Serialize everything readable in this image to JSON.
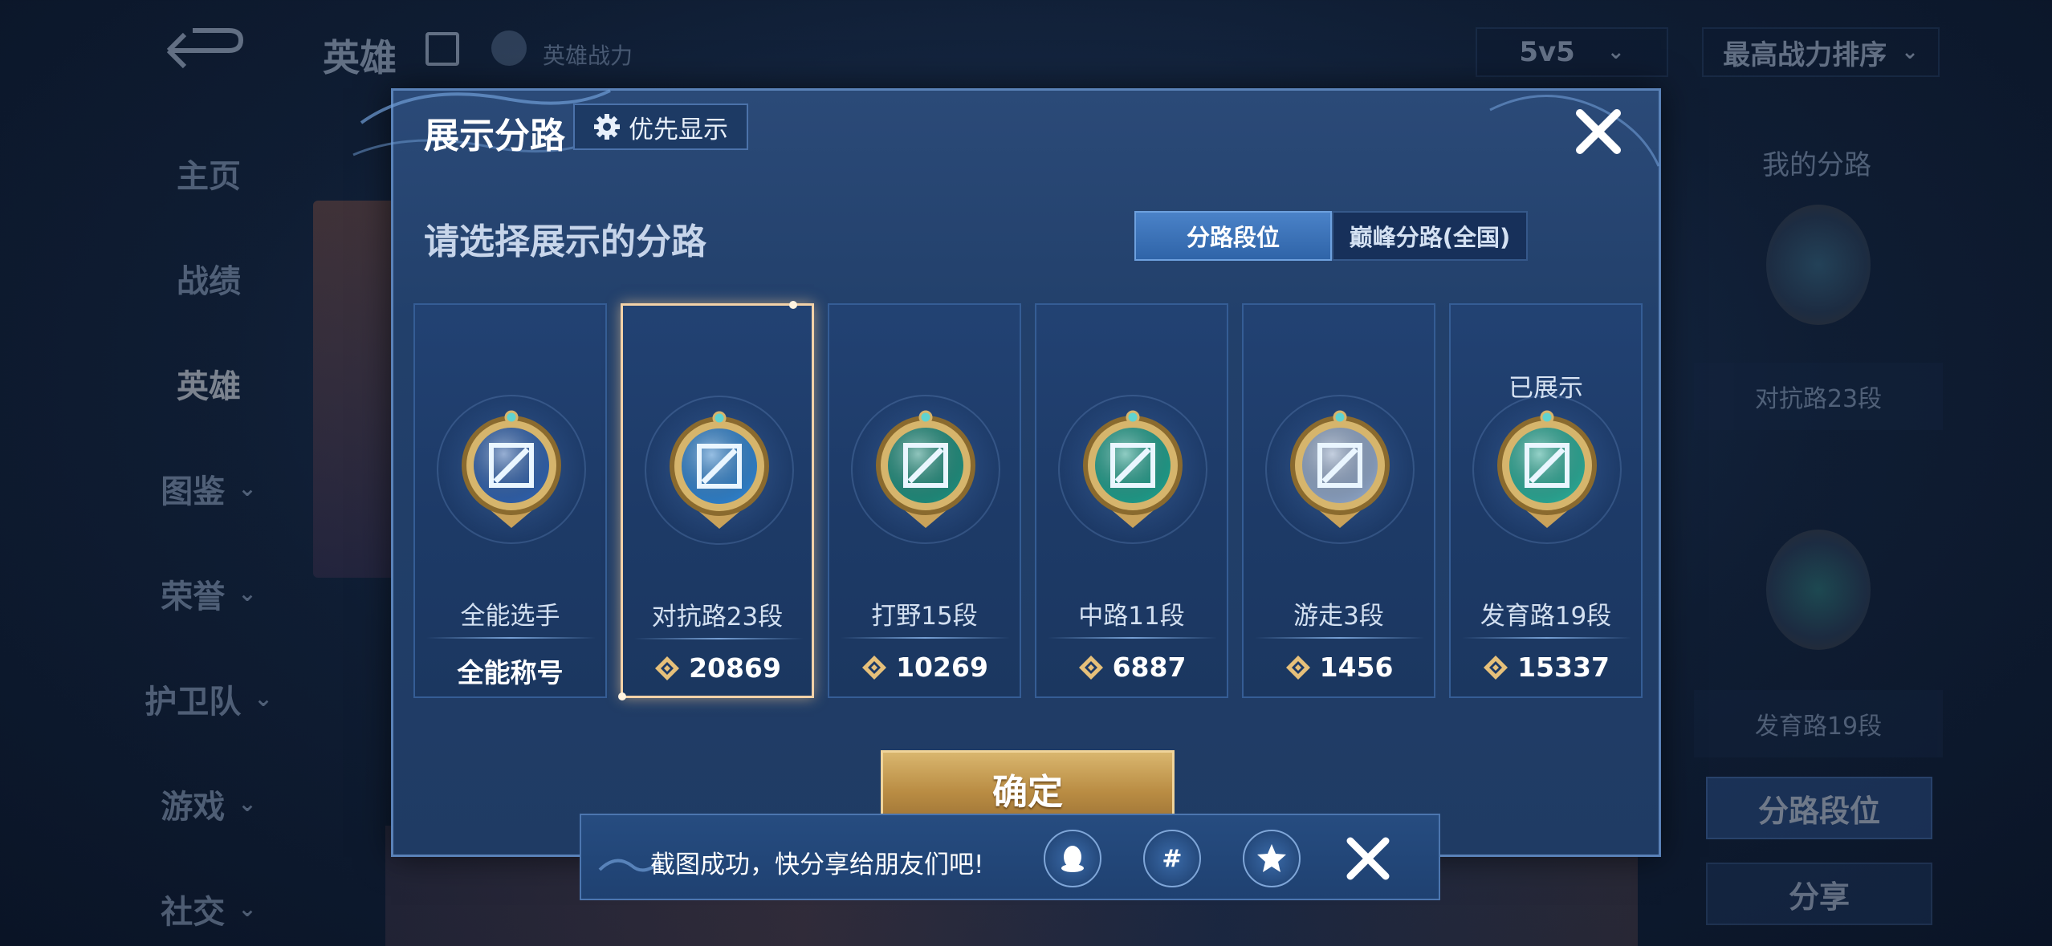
{
  "background": {
    "title": "英雄",
    "subtitle": "英雄战力",
    "mode_select": "5v5",
    "sort_select": "最高战力排序",
    "sidebar": [
      {
        "label": "主页",
        "has_chevron": false
      },
      {
        "label": "战绩",
        "has_chevron": false
      },
      {
        "label": "英雄",
        "has_chevron": false,
        "active": true
      },
      {
        "label": "图鉴",
        "has_chevron": true
      },
      {
        "label": "荣誉",
        "has_chevron": true
      },
      {
        "label": "护卫队",
        "has_chevron": true
      },
      {
        "label": "游戏",
        "has_chevron": true
      },
      {
        "label": "社交",
        "has_chevron": true
      }
    ],
    "right_panel": {
      "title": "我的分路",
      "label1": "对抗路23段",
      "label2": "发育路19段",
      "button1": "分路段位",
      "button2": "分享"
    }
  },
  "modal": {
    "title": "展示分路",
    "priority_button": "优先显示",
    "prompt": "请选择展示的分路",
    "tabs": [
      {
        "label": "分路段位",
        "active": true
      },
      {
        "label": "巅峰分路(全国)",
        "active": false
      }
    ],
    "cards": [
      {
        "rank": "全能选手",
        "score": "全能称号",
        "show_diamond": false,
        "shown_label": "",
        "emblem": "all-round-emblem-icon",
        "emblem_color": "#2f5fa8",
        "selected": false
      },
      {
        "rank": "对抗路23段",
        "score": "20869",
        "show_diamond": true,
        "shown_label": "",
        "emblem": "clash-lane-emblem-icon",
        "emblem_color": "#2f7fc8",
        "selected": true
      },
      {
        "rank": "打野15段",
        "score": "10269",
        "show_diamond": true,
        "shown_label": "",
        "emblem": "jungle-emblem-icon",
        "emblem_color": "#1f8a7a",
        "selected": false
      },
      {
        "rank": "中路11段",
        "score": "6887",
        "show_diamond": true,
        "shown_label": "",
        "emblem": "mid-lane-emblem-icon",
        "emblem_color": "#1f9a88",
        "selected": false
      },
      {
        "rank": "游走3段",
        "score": "1456",
        "show_diamond": true,
        "shown_label": "",
        "emblem": "roam-emblem-icon",
        "emblem_color": "#8aa0c0",
        "selected": false
      },
      {
        "rank": "发育路19段",
        "score": "15337",
        "show_diamond": true,
        "shown_label": "已展示",
        "emblem": "farm-lane-emblem-icon",
        "emblem_color": "#2aa592",
        "selected": false
      }
    ],
    "confirm_button": "确定"
  },
  "toast": {
    "text": "截图成功，快分享给朋友们吧!",
    "share_icons": [
      "qq-share-icon",
      "wechat-moments-share-icon",
      "qzone-share-icon"
    ]
  },
  "colors": {
    "gold": "#c9a25a",
    "selected_border": "#f3d2a8",
    "active_tab": "#3a74bc"
  }
}
